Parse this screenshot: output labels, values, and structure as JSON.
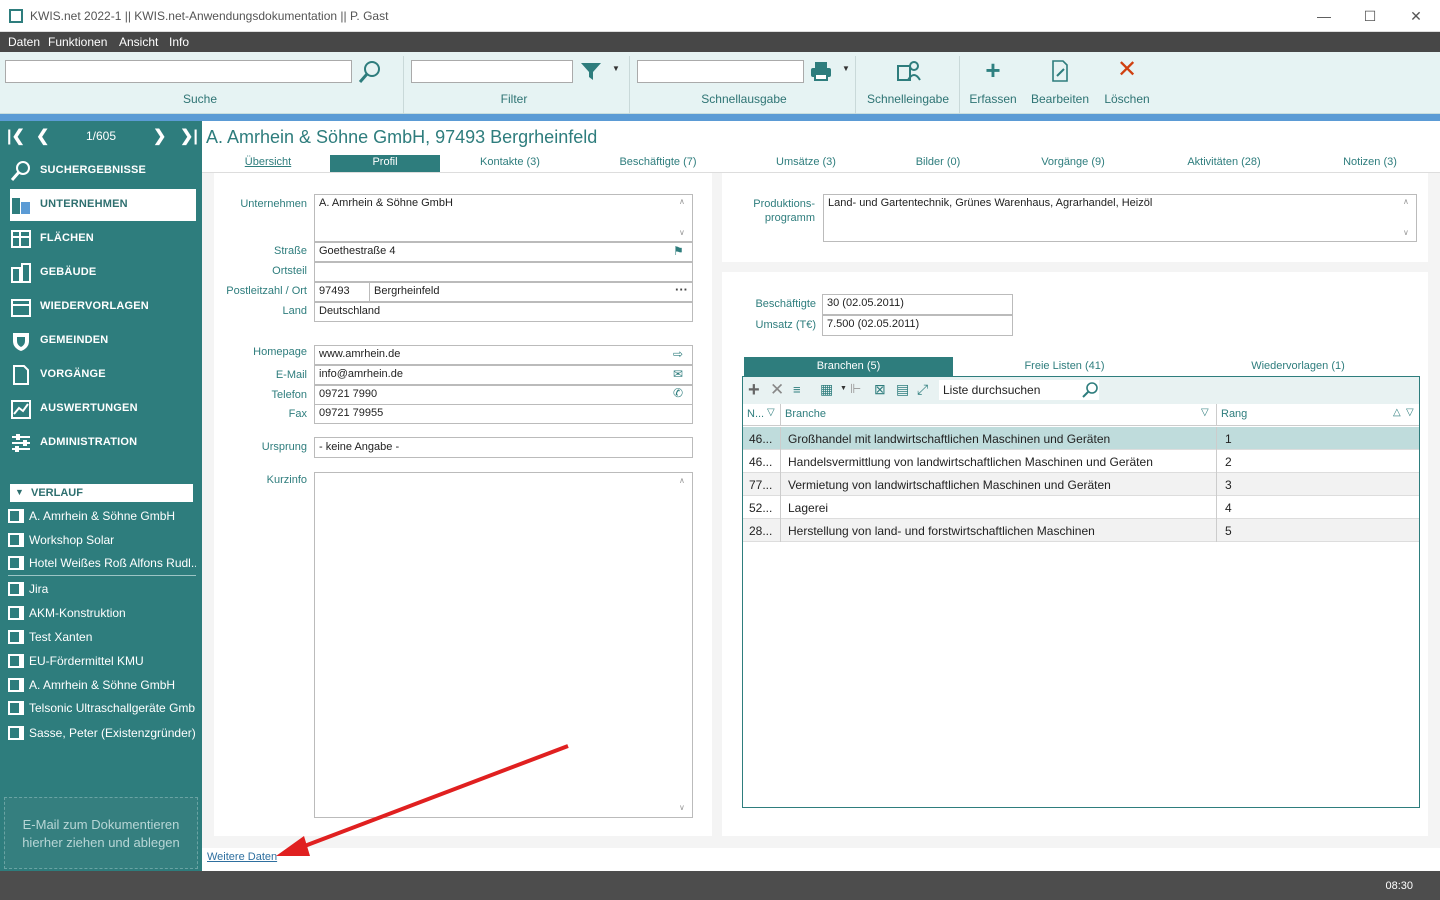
{
  "window": {
    "title": "KWIS.net 2022-1 || KWIS.net-Anwendungsdokumentation || P. Gast"
  },
  "menu": [
    "Daten",
    "Funktionen",
    "Ansicht",
    "Info"
  ],
  "ribbon": {
    "search_label": "Suche",
    "filter_label": "Filter",
    "quickout_label": "Schnellausgabe",
    "quickentry_label": "Schnelleingabe",
    "create_label": "Erfassen",
    "edit_label": "Bearbeiten",
    "delete_label": "Löschen"
  },
  "nav": {
    "counter": "1/605"
  },
  "sidebar": {
    "items": [
      {
        "label": "SUCHERGEBNISSE",
        "icon": "search-icon"
      },
      {
        "label": "UNTERNEHMEN",
        "icon": "building-icon",
        "active": true
      },
      {
        "label": "FLÄCHEN",
        "icon": "area-icon"
      },
      {
        "label": "GEBÄUDE",
        "icon": "buildings-icon"
      },
      {
        "label": "WIEDERVORLAGEN",
        "icon": "calendar-icon"
      },
      {
        "label": "GEMEINDEN",
        "icon": "shield-icon"
      },
      {
        "label": "VORGÄNGE",
        "icon": "document-icon"
      },
      {
        "label": "AUSWERTUNGEN",
        "icon": "chart-icon"
      },
      {
        "label": "ADMINISTRATION",
        "icon": "settings-icon"
      }
    ],
    "history_title": "VERLAUF",
    "history": [
      "A. Amrhein & Söhne GmbH",
      "Workshop Solar",
      "Hotel Weißes Roß Alfons Rudl...",
      "Jira",
      "AKM-Konstruktion",
      "Test Xanten",
      "EU-Fördermittel KMU",
      "A. Amrhein & Söhne GmbH",
      "Telsonic Ultraschallgeräte Gmb...",
      "Sasse, Peter (Existenzgründer)"
    ],
    "dropzone_line1": "E-Mail  zum Dokumentieren",
    "dropzone_line2": "hierher ziehen und ablegen"
  },
  "record": {
    "title": "A. Amrhein & Söhne GmbH, 97493 Bergrheinfeld",
    "tabs": [
      "Übersicht",
      "Profil",
      "Kontakte (3)",
      "Beschäftigte (7)",
      "Umsätze (3)",
      "Bilder (0)",
      "Vorgänge (9)",
      "Aktivitäten (28)",
      "Notizen (3)"
    ]
  },
  "profile": {
    "labels": {
      "company": "Unternehmen",
      "street": "Straße",
      "district": "Ortsteil",
      "zip_city": "Postleitzahl / Ort",
      "country": "Land",
      "homepage": "Homepage",
      "email": "E-Mail",
      "phone": "Telefon",
      "fax": "Fax",
      "origin": "Ursprung",
      "shortinfo": "Kurzinfo",
      "program1": "Produktions-",
      "program2": "programm",
      "employees": "Beschäftigte",
      "revenue": "Umsatz (T€)"
    },
    "company": "A. Amrhein & Söhne GmbH",
    "street": "Goethestraße 4",
    "district": "",
    "zip": "97493",
    "city": "Bergrheinfeld",
    "country": "Deutschland",
    "homepage": "www.amrhein.de",
    "email": "info@amrhein.de",
    "phone": "09721 7990",
    "fax": "09721 79955",
    "origin": "- keine Angabe -",
    "program": "Land- und Gartentechnik, Grünes Warenhaus, Agrarhandel, Heizöl",
    "employees": "30  (02.05.2011)",
    "revenue": "7.500 (02.05.2011)"
  },
  "grid": {
    "tabs": [
      "Branchen (5)",
      "Freie Listen (41)",
      "Wiedervorlagen (1)"
    ],
    "search_placeholder": "Liste durchsuchen",
    "headers": [
      "N...",
      "Branche",
      "Rang"
    ],
    "rows": [
      {
        "n": "46...",
        "branche": "Großhandel mit landwirtschaftlichen Maschinen und Geräten",
        "rang": "1"
      },
      {
        "n": "46...",
        "branche": "Handelsvermittlung von landwirtschaftlichen Maschinen und Geräten",
        "rang": "2"
      },
      {
        "n": "77...",
        "branche": "Vermietung von landwirtschaftlichen Maschinen und Geräten",
        "rang": "3"
      },
      {
        "n": "52...",
        "branche": "Lagerei",
        "rang": "4"
      },
      {
        "n": "28...",
        "branche": "Herstellung von land- und forstwirtschaftlichen Maschinen",
        "rang": "5"
      }
    ]
  },
  "footer": {
    "more_data": "Weitere Daten"
  },
  "status": {
    "clock": "08:30"
  },
  "colors": {
    "accent": "#2e7d7d",
    "ribbon": "#e6f3f3",
    "selected_row": "#bfdcdc",
    "annotation_arrow": "#e02020"
  }
}
